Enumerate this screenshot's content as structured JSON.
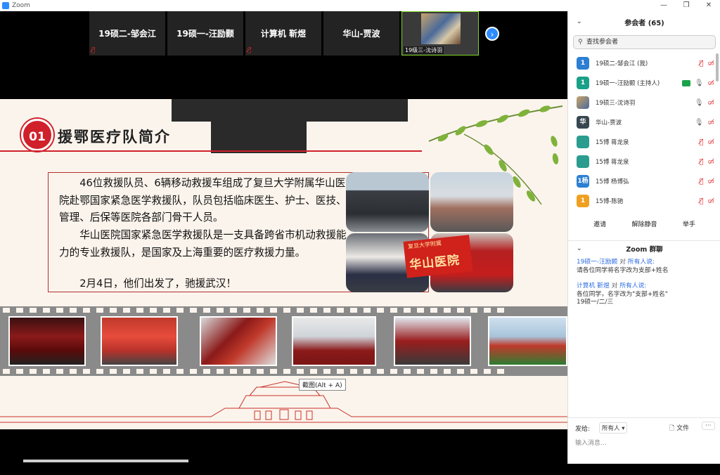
{
  "window": {
    "title": "Zoom",
    "min": "—",
    "max": "❐",
    "close": "✕"
  },
  "video_strip": {
    "tiles": [
      {
        "name": "19硕二-邹会江",
        "muted": true
      },
      {
        "name": "19硕一-汪励颢",
        "muted": false
      },
      {
        "name": "计算机 靳煜",
        "muted": true
      },
      {
        "name": "华山-贾波",
        "muted": false
      }
    ],
    "video_tile_caption": "19级三-沈诗羽",
    "next_icon": "chevron-right-icon"
  },
  "slide": {
    "number": "01",
    "title": "援鄂医疗队简介",
    "paragraph1": "46位救援队员、6辆移动救援车组成了复旦大学附属华山医院赴鄂国家紧急医学救援队，队员包括临床医生、护士、医技、管理、后保等医院各部门骨干人员。",
    "paragraph2": "华山医院国家紧急医学救援队是一支具备跨省市机动救援能力的专业救援队，是国家及上海重要的医疗救援力量。",
    "paragraph3": "2月4日，他们出发了，驰援武汉！",
    "banner_text": "华山医院",
    "banner_top": "复旦大学附属",
    "tooltip": "截图(Alt + A)"
  },
  "participants_panel": {
    "title": "参会者 (65)",
    "search_placeholder": "查找参会者",
    "participants": [
      {
        "avatar": "1",
        "color": "#2d7fd3",
        "name": "19硕二-邹会江 (我)",
        "mic": "off",
        "video": "off",
        "sharing": false
      },
      {
        "avatar": "1",
        "color": "#1aa088",
        "name": "19硕一-汪励颢 (主持人)",
        "mic": "on",
        "video": "off",
        "sharing": true
      },
      {
        "avatar": "",
        "color": "#7a5a3a",
        "name": "19硕三-沈诗羽",
        "mic": "on",
        "video": "off",
        "sharing": false
      },
      {
        "avatar": "华",
        "color": "#37474f",
        "name": "华山-贾波",
        "mic": "on",
        "video": "off",
        "sharing": false
      },
      {
        "avatar": "",
        "color": "#2a9d8f",
        "name": "15博 蒋龙泉",
        "mic": "off",
        "video": "off",
        "sharing": false
      },
      {
        "avatar": "",
        "color": "#2a9d8f",
        "name": "15博 蒋龙泉",
        "mic": "off",
        "video": "off",
        "sharing": false
      },
      {
        "avatar": "1杨",
        "color": "#2d7fd3",
        "name": "15博 杨博弘",
        "mic": "off",
        "video": "off",
        "sharing": false
      },
      {
        "avatar": "1",
        "color": "#f0a020",
        "name": "15博-陈驰",
        "mic": "off",
        "video": "off",
        "sharing": false
      }
    ],
    "buttons": {
      "invite": "邀请",
      "unmute_all": "解除静音",
      "raise_hand": "举手"
    }
  },
  "chat_panel": {
    "title": "Zoom 群聊",
    "messages": [
      {
        "from": "19硕一-汪励颢",
        "to_label": "对",
        "to": "所有人说:",
        "body": "请各位同学将名字改为支部+姓名"
      },
      {
        "from": "计算机 靳煜",
        "to_label": "对",
        "to": "所有人说:",
        "body": "各位同学，名字改为\"支部+姓名\"",
        "body2": "19硕一/二/三"
      }
    ],
    "send_to_label": "发给:",
    "send_to_value": "所有人 ▾",
    "file_label": "文件",
    "more_label": "···",
    "input_placeholder": "输入消息..."
  }
}
